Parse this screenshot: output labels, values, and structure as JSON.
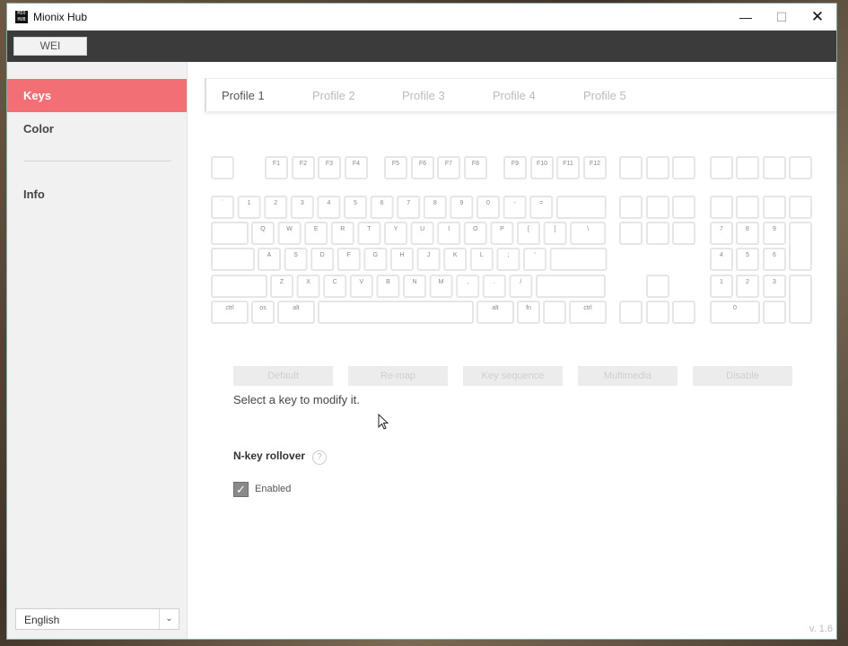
{
  "window": {
    "title": "Mionix Hub",
    "icon_text": "MIO HUB"
  },
  "titlebar_controls": {
    "minimize": "—",
    "maximize": "☐",
    "close": "✕"
  },
  "user_button": "WEI",
  "sidebar": {
    "items": [
      {
        "label": "Keys",
        "active": true
      },
      {
        "label": "Color",
        "active": false
      },
      {
        "label": "Info",
        "active": false
      }
    ],
    "language": "English"
  },
  "profiles": [
    {
      "label": "Profile 1",
      "active": true
    },
    {
      "label": "Profile 2",
      "active": false
    },
    {
      "label": "Profile 3",
      "active": false
    },
    {
      "label": "Profile 4",
      "active": false
    },
    {
      "label": "Profile 5",
      "active": false
    }
  ],
  "keyboard": {
    "fn_row": [
      "",
      "F1",
      "F2",
      "F3",
      "F4",
      "F5",
      "F6",
      "F7",
      "F8",
      "F9",
      "F10",
      "F11",
      "F12"
    ],
    "number_row": [
      "`",
      "1",
      "2",
      "3",
      "4",
      "5",
      "6",
      "7",
      "8",
      "9",
      "0",
      "-",
      "=",
      ""
    ],
    "q_row": [
      "",
      "Q",
      "W",
      "E",
      "R",
      "T",
      "Y",
      "U",
      "I",
      "O",
      "P",
      "[",
      "]",
      "\\"
    ],
    "a_row": [
      "",
      "A",
      "S",
      "D",
      "F",
      "G",
      "H",
      "J",
      "K",
      "L",
      ";",
      "'",
      ""
    ],
    "z_row": [
      "",
      "Z",
      "X",
      "C",
      "V",
      "B",
      "N",
      "M",
      ",",
      ".",
      "/",
      ""
    ],
    "bottom_row": [
      "ctrl",
      "os",
      "alt",
      "",
      "alt",
      "fn",
      "",
      "ctrl"
    ],
    "numpad": [
      "7",
      "8",
      "9",
      "4",
      "5",
      "6",
      "1",
      "2",
      "3",
      "0"
    ]
  },
  "actions": [
    "Default",
    "Re-map",
    "Key sequence",
    "Multimedia",
    "Disable"
  ],
  "hint_text": "Select a key to modify it.",
  "nkey": {
    "title": "N-key rollover",
    "help": "?",
    "enabled_label": "Enabled",
    "enabled": true
  },
  "version": "v. 1.6"
}
